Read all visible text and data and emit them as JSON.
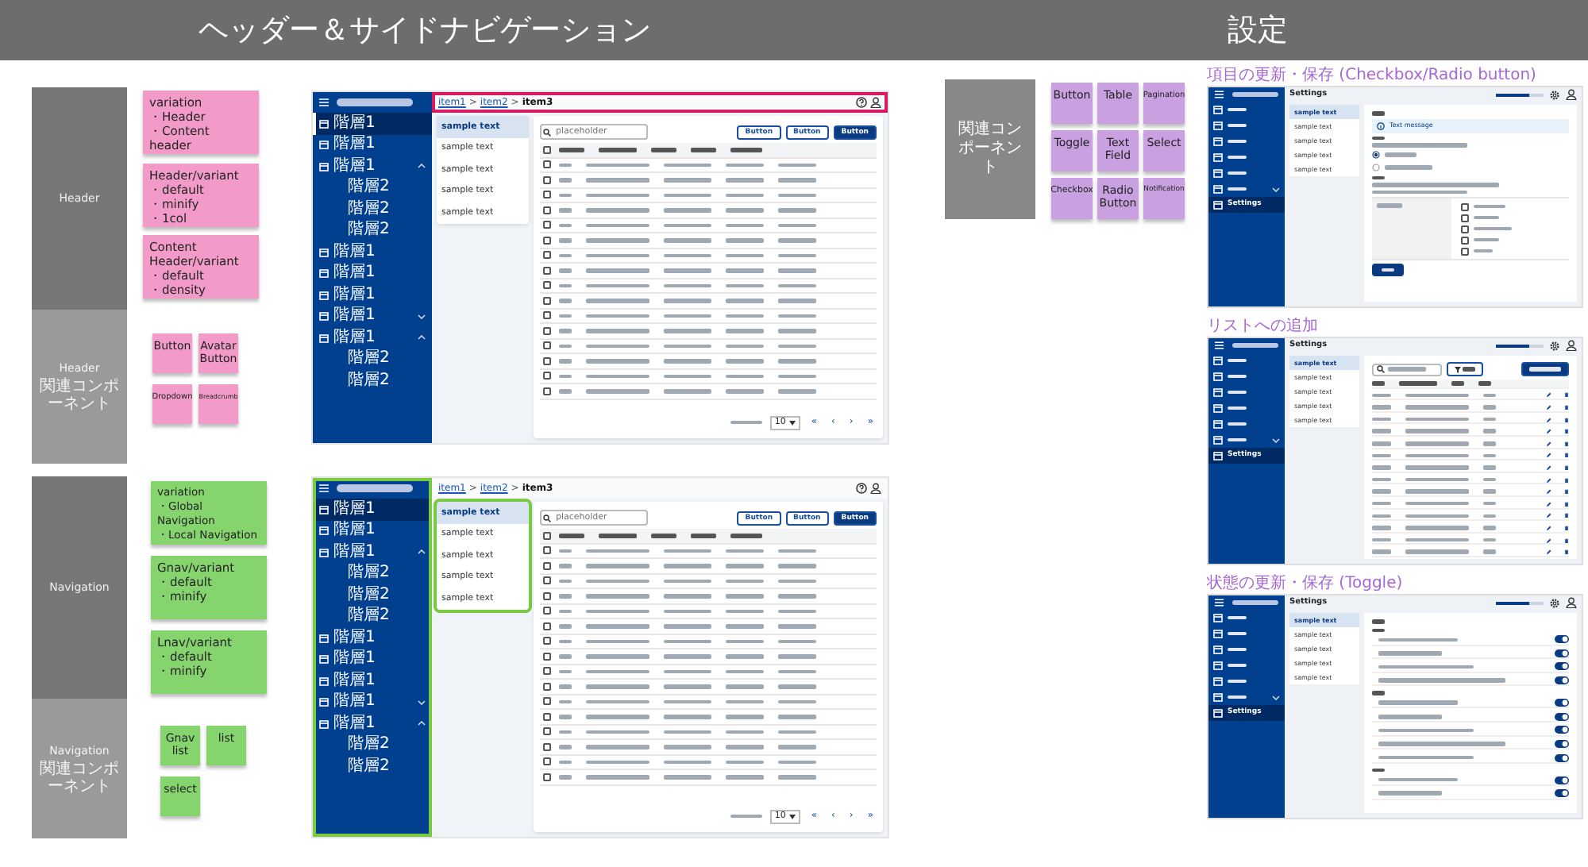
{
  "sections": [
    {
      "title": "ヘッダー＆サイドナビゲーション"
    },
    {
      "title": "設定"
    }
  ],
  "groups": [
    {
      "label": "Header",
      "related_label": [
        "Header",
        "関連コンポーネント"
      ],
      "color": "#f29bc9",
      "notes": [
        {
          "title": "variation",
          "bullets": [
            "・Header",
            "・Content header"
          ]
        },
        {
          "title": "Header/variant",
          "bullets": [
            "・default",
            "・minify",
            "・1col"
          ]
        },
        {
          "title": "Content Header/variant",
          "bullets": [
            "・default",
            "・density"
          ]
        }
      ],
      "chips": [
        "Button",
        "Avatar Button",
        "Dropdown",
        "Breadcrumb"
      ]
    },
    {
      "label": "Navigation",
      "related_label": [
        "Navigation",
        "関連コンポーネント"
      ],
      "color": "#86d46e",
      "notes": [
        {
          "title": "variation",
          "bullets": [
            "・Global Navigation",
            "・Local Navigation"
          ]
        },
        {
          "title": "Gnav/variant",
          "bullets": [
            "・default",
            "・minify"
          ]
        },
        {
          "title": "Lnav/variant",
          "bullets": [
            "・default",
            "・minify"
          ]
        }
      ],
      "chips": [
        "Gnav list",
        "list",
        "select"
      ]
    }
  ],
  "mockups": [
    {
      "highlight_header": true,
      "highlight_nav": false,
      "breadcrumb": {
        "items": [
          "item1",
          "item2",
          "item3"
        ],
        "separator": ">"
      },
      "nav": [
        {
          "label": "階層1",
          "selected": true
        },
        {
          "label": "階層1",
          "selected": false
        },
        {
          "label": "階層1",
          "selected": false,
          "expanded": true,
          "children": [
            {
              "label": "階層2",
              "selected": false
            },
            {
              "label": "階層2",
              "selected": false
            },
            {
              "label": "階層2",
              "selected": false
            }
          ]
        },
        {
          "label": "階層1",
          "selected": false
        },
        {
          "label": "階層1",
          "selected": false
        },
        {
          "label": "階層1",
          "selected": false
        },
        {
          "label": "階層1",
          "selected": false,
          "expanded": false
        },
        {
          "label": "階層1",
          "selected": false,
          "expanded": true,
          "children": [
            {
              "label": "階層2",
              "selected": false
            },
            {
              "label": "階層2",
              "selected": false
            }
          ]
        }
      ],
      "list_items": [
        {
          "label": "sample text",
          "selected": true
        },
        {
          "label": "sample text",
          "selected": false
        },
        {
          "label": "sample text",
          "selected": false
        },
        {
          "label": "sample text",
          "selected": false
        },
        {
          "label": "sample text",
          "selected": false
        }
      ],
      "search_placeholder": "placeholder",
      "buttons": [
        {
          "label": "Button",
          "kind": "outline"
        },
        {
          "label": "Button",
          "kind": "outline"
        },
        {
          "label": "Button",
          "kind": "primary"
        }
      ],
      "select_all": {
        "checked": false
      },
      "rows": [
        {
          "checked": false
        },
        {
          "checked": false
        },
        {
          "checked": false
        },
        {
          "checked": false
        },
        {
          "checked": false
        },
        {
          "checked": false
        },
        {
          "checked": false
        },
        {
          "checked": false
        },
        {
          "checked": false
        },
        {
          "checked": false
        },
        {
          "checked": false
        },
        {
          "checked": false
        },
        {
          "checked": false
        },
        {
          "checked": false
        },
        {
          "checked": false
        },
        {
          "checked": false
        }
      ],
      "page_size": "10",
      "pager": [
        "«",
        "‹",
        "›",
        "»"
      ]
    },
    {
      "highlight_header": false,
      "highlight_nav": true,
      "breadcrumb": {
        "items": [
          "item1",
          "item2",
          "item3"
        ],
        "separator": ">"
      },
      "nav": [
        {
          "label": "階層1",
          "selected": true
        },
        {
          "label": "階層1",
          "selected": false
        },
        {
          "label": "階層1",
          "selected": false,
          "expanded": true,
          "children": [
            {
              "label": "階層2",
              "selected": false
            },
            {
              "label": "階層2",
              "selected": false
            },
            {
              "label": "階層2",
              "selected": false
            }
          ]
        },
        {
          "label": "階層1",
          "selected": false
        },
        {
          "label": "階層1",
          "selected": false
        },
        {
          "label": "階層1",
          "selected": false
        },
        {
          "label": "階層1",
          "selected": false,
          "expanded": false
        },
        {
          "label": "階層1",
          "selected": false,
          "expanded": true,
          "children": [
            {
              "label": "階層2",
              "selected": false
            },
            {
              "label": "階層2",
              "selected": false
            }
          ]
        }
      ],
      "list_items": [
        {
          "label": "sample text",
          "selected": true
        },
        {
          "label": "sample text",
          "selected": false
        },
        {
          "label": "sample text",
          "selected": false
        },
        {
          "label": "sample text",
          "selected": false
        },
        {
          "label": "sample text",
          "selected": false
        }
      ],
      "search_placeholder": "placeholder",
      "buttons": [
        {
          "label": "Button",
          "kind": "outline"
        },
        {
          "label": "Button",
          "kind": "outline"
        },
        {
          "label": "Button",
          "kind": "primary"
        }
      ],
      "select_all": {
        "checked": false
      },
      "rows": [
        {
          "checked": false
        },
        {
          "checked": false
        },
        {
          "checked": false
        },
        {
          "checked": false
        },
        {
          "checked": false
        },
        {
          "checked": false
        },
        {
          "checked": false
        },
        {
          "checked": false
        },
        {
          "checked": false
        },
        {
          "checked": false
        },
        {
          "checked": false
        },
        {
          "checked": false
        },
        {
          "checked": false
        },
        {
          "checked": false
        },
        {
          "checked": false
        },
        {
          "checked": false
        }
      ],
      "page_size": "10",
      "pager": [
        "«",
        "‹",
        "›",
        "»"
      ]
    }
  ],
  "related": {
    "label": "関連コンポーネント",
    "color": "#c9a0e0",
    "chips": [
      "Button",
      "Table",
      "Pagination",
      "Toggle",
      "Text Field",
      "Select",
      "Checkbox",
      "Radio Button",
      "Notification"
    ]
  },
  "screens": [
    {
      "kind": "form",
      "title": "項目の更新・保存 (Checkbox/Radio button)",
      "header_title": "Settings",
      "usage": {
        "level": 0.7
      },
      "nav": [
        {
          "selected": false
        },
        {
          "selected": false
        },
        {
          "selected": false
        },
        {
          "selected": false
        },
        {
          "selected": false
        },
        {
          "selected": false,
          "expanded": false
        },
        {
          "label": "Settings",
          "selected": true
        }
      ],
      "sub_items": [
        {
          "label": "sample text",
          "selected": true
        },
        {
          "label": "sample text",
          "selected": false
        },
        {
          "label": "sample text",
          "selected": false
        },
        {
          "label": "sample text",
          "selected": false
        },
        {
          "label": "sample text",
          "selected": false
        }
      ],
      "message": "Text message",
      "radios": [
        {
          "selected": true
        },
        {
          "selected": false
        }
      ],
      "checkboxes": [
        {
          "checked": false
        },
        {
          "checked": false
        },
        {
          "checked": false
        },
        {
          "checked": false
        },
        {
          "checked": false
        }
      ]
    },
    {
      "kind": "list",
      "title": "リストへの追加",
      "header_title": "Settings",
      "usage": {
        "level": 0.7
      },
      "nav": [
        {
          "selected": false
        },
        {
          "selected": false
        },
        {
          "selected": false
        },
        {
          "selected": false
        },
        {
          "selected": false
        },
        {
          "selected": false,
          "expanded": false
        },
        {
          "label": "Settings",
          "selected": true
        }
      ],
      "sub_items": [
        {
          "label": "sample text",
          "selected": true
        },
        {
          "label": "sample text",
          "selected": false
        },
        {
          "label": "sample text",
          "selected": false
        },
        {
          "label": "sample text",
          "selected": false
        },
        {
          "label": "sample text",
          "selected": false
        }
      ]
    },
    {
      "kind": "toggles",
      "title": "状態の更新・保存 (Toggle)",
      "header_title": "Settings",
      "usage": {
        "level": 0.7
      },
      "nav": [
        {
          "selected": false
        },
        {
          "selected": false
        },
        {
          "selected": false
        },
        {
          "selected": false
        },
        {
          "selected": false
        },
        {
          "selected": false,
          "expanded": false
        },
        {
          "label": "Settings",
          "selected": true
        }
      ],
      "sub_items": [
        {
          "label": "sample text",
          "selected": true
        },
        {
          "label": "sample text",
          "selected": false
        },
        {
          "label": "sample text",
          "selected": false
        },
        {
          "label": "sample text",
          "selected": false
        },
        {
          "label": "sample text",
          "selected": false
        }
      ],
      "toggle_groups": [
        {
          "toggles": [
            {
              "on": true
            },
            {
              "on": true
            },
            {
              "on": true
            },
            {
              "on": true
            }
          ]
        },
        {
          "toggles": [
            {
              "on": true
            },
            {
              "on": true
            },
            {
              "on": true
            },
            {
              "on": true
            },
            {
              "on": true
            }
          ]
        },
        {
          "toggles": [
            {
              "on": true
            },
            {
              "on": true
            }
          ]
        }
      ]
    }
  ]
}
